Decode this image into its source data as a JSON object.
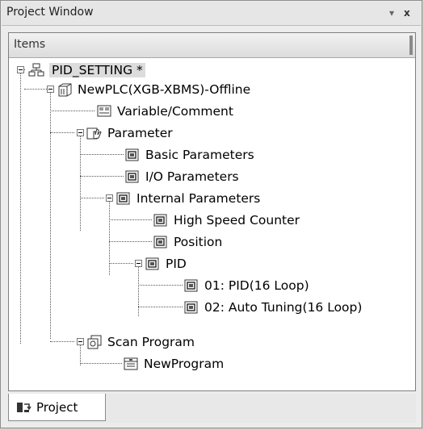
{
  "window": {
    "title": "Project Window",
    "pin_glyph": "▾",
    "close_glyph": "x"
  },
  "panel": {
    "header_label": "Items"
  },
  "tree": {
    "root": "PID_SETTING *",
    "plc": "NewPLC(XGB-XBMS)-Offline",
    "variable": "Variable/Comment",
    "parameter": "Parameter",
    "basic": "Basic Parameters",
    "io": "I/O Parameters",
    "internal": "Internal Parameters",
    "hsc": "High Speed Counter",
    "position": "Position",
    "pid": "PID",
    "pid01": "01: PID(16 Loop)",
    "pid02": "02: Auto Tuning(16 Loop)",
    "scan": "Scan Program",
    "program": "NewProgram"
  },
  "tabs": {
    "project": "Project"
  },
  "icons": {
    "root": "project-tree-icon",
    "plc": "plc-module-icon",
    "variable": "variable-comment-icon",
    "parameter": "parameter-hand-icon",
    "param_item": "parameter-item-icon",
    "scan": "scan-program-icon",
    "program": "program-file-icon",
    "tab": "project-tab-icon"
  }
}
